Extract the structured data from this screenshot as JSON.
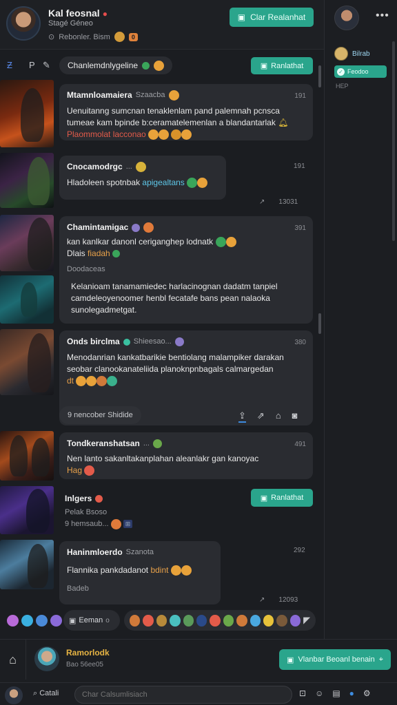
{
  "header": {
    "title": "Kal feosnal",
    "subtitle": "Stagé Géneo",
    "status": "Rebonler. Bism",
    "badge": "0",
    "button": "Clar Realanhat"
  },
  "right_panel": {
    "menu": "•••",
    "user": "Bilrab",
    "chip": "Feodoo",
    "small": "HEP"
  },
  "toolbar": {
    "pill": "Chanlemdnlygeline",
    "button": "Ranlathat"
  },
  "messages": [
    {
      "name": "Mtamnloamaiera",
      "sub": "Szaacba",
      "time": "191",
      "lines": [
        "Uenuitanng sumcnan tenaklenlam pand palemnah pcnsca",
        "tumeae kam bpinde b:ceramatelemenlan a blandantarlak"
      ],
      "highlight": "Plaommolat lacconao"
    },
    {
      "name": "Cnocamodrgc",
      "sub": "...",
      "time": "191",
      "line_plain": "Hladoleen spotnbak",
      "line_hl": "apigealtans",
      "footer": "13031"
    },
    {
      "name": "Chamintamigac",
      "time": "391",
      "lines": [
        "kan kanlkar danonl ceriganghep lodnatk"
      ],
      "line_plain": "Dlais",
      "line_hl": "fiadah",
      "quote": "Doodaceas",
      "body": [
        "Kelanioam tanamamiedec harlacinognan dadatm tanpiel",
        "camdeleoyenoomer henbl fecatafe bans pean nalaoka",
        "sunolegadmetgat."
      ]
    },
    {
      "name": "Onds birclma",
      "sub": "Shieesao...",
      "time": "380",
      "lines": [
        "Menodanrian kankatbarikie bentiolang malampiker darakan",
        "seobar clanookanateliida planoknpnbagals calmargedan"
      ],
      "line_hl": "dt",
      "reply": "9 nencober Shidide"
    },
    {
      "name": "Tondkeranshatsan",
      "sub": "...",
      "time": "491",
      "lines": [
        "Nen lanto sakanltakanplahan aleanlakr gan kanoyac"
      ],
      "line_hl": "Hag"
    },
    {
      "name": "Inlgers",
      "sub1": "Pelak Bsoso",
      "sub2": "9 hemsaub...",
      "button": "Ranlathat"
    },
    {
      "name": "Haninmloerdo",
      "sub": "Szanota",
      "time": "292",
      "lines": [
        "Flannika pankdadanot"
      ],
      "line_hl": "bdint",
      "quote": "Badeb",
      "footer": "12093"
    }
  ],
  "strip": {
    "label": "Eeman"
  },
  "bottom": {
    "name": "Ramorlodk",
    "sub": "Bao 56ee05",
    "button": "Vlanbar Beoanl benain",
    "search_label": "Catali",
    "input_placeholder": "Char Calsumlisiach"
  },
  "colors": {
    "accent": "#2aa58c",
    "panel": "#2a2c31",
    "bg": "#1b1d21",
    "highlight_red": "#e35b4a",
    "highlight_cyan": "#5ec7e8"
  }
}
